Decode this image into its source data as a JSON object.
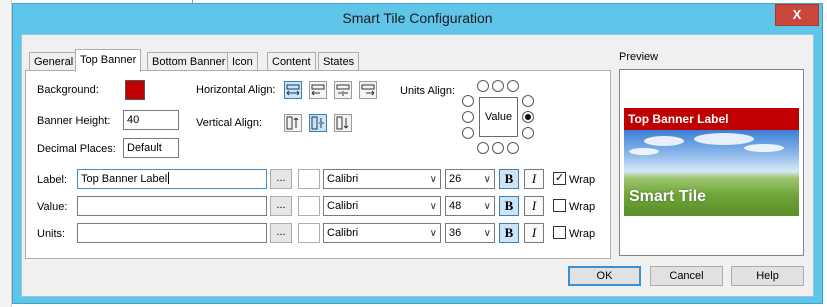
{
  "window": {
    "title": "Smart Tile Configuration",
    "close_glyph": "X"
  },
  "tabs": [
    {
      "label": "General",
      "active": false
    },
    {
      "label": "Top Banner",
      "active": true
    },
    {
      "label": "Bottom Banner",
      "active": false
    },
    {
      "label": "Icon",
      "active": false
    },
    {
      "label": "Content",
      "active": false
    },
    {
      "label": "States",
      "active": false
    }
  ],
  "banner": {
    "background_label": "Background:",
    "background_color": "#c00000",
    "height_label": "Banner Height:",
    "height_value": "40",
    "decimal_label": "Decimal Places:",
    "decimal_value": "Default",
    "halign_label": "Horizontal Align:",
    "valign_label": "Vertical Align:",
    "halign_icons": [
      "align-stretch-icon",
      "align-left-icon",
      "align-center-icon",
      "align-right-icon"
    ],
    "valign_icons": [
      "align-top-icon",
      "align-middle-icon",
      "align-bottom-icon"
    ],
    "units_align_label": "Units Align:",
    "units_box_label": "Value",
    "units_selected": "right"
  },
  "rows": [
    {
      "label": "Label:",
      "value": "Top Banner Label",
      "browse": "...",
      "font": "Calibri",
      "size": "26",
      "bold": "B",
      "italic": "I",
      "wrap_label": "Wrap",
      "wrap_checked": true,
      "check_glyph": "✓"
    },
    {
      "label": "Value:",
      "value": "",
      "browse": "...",
      "font": "Calibri",
      "size": "48",
      "bold": "B",
      "italic": "I",
      "wrap_label": "Wrap",
      "wrap_checked": false,
      "check_glyph": ""
    },
    {
      "label": "Units:",
      "value": "",
      "browse": "...",
      "font": "Calibri",
      "size": "36",
      "bold": "B",
      "italic": "I",
      "wrap_label": "Wrap",
      "wrap_checked": false,
      "check_glyph": ""
    }
  ],
  "preview": {
    "label": "Preview",
    "banner_text": "Top Banner Label",
    "banner_color": "#c00000",
    "tile_text": "Smart Tile"
  },
  "buttons": {
    "ok": "OK",
    "cancel": "Cancel",
    "help": "Help"
  },
  "icons": {
    "chevron": "chevron-down-icon",
    "close": "close-icon"
  }
}
